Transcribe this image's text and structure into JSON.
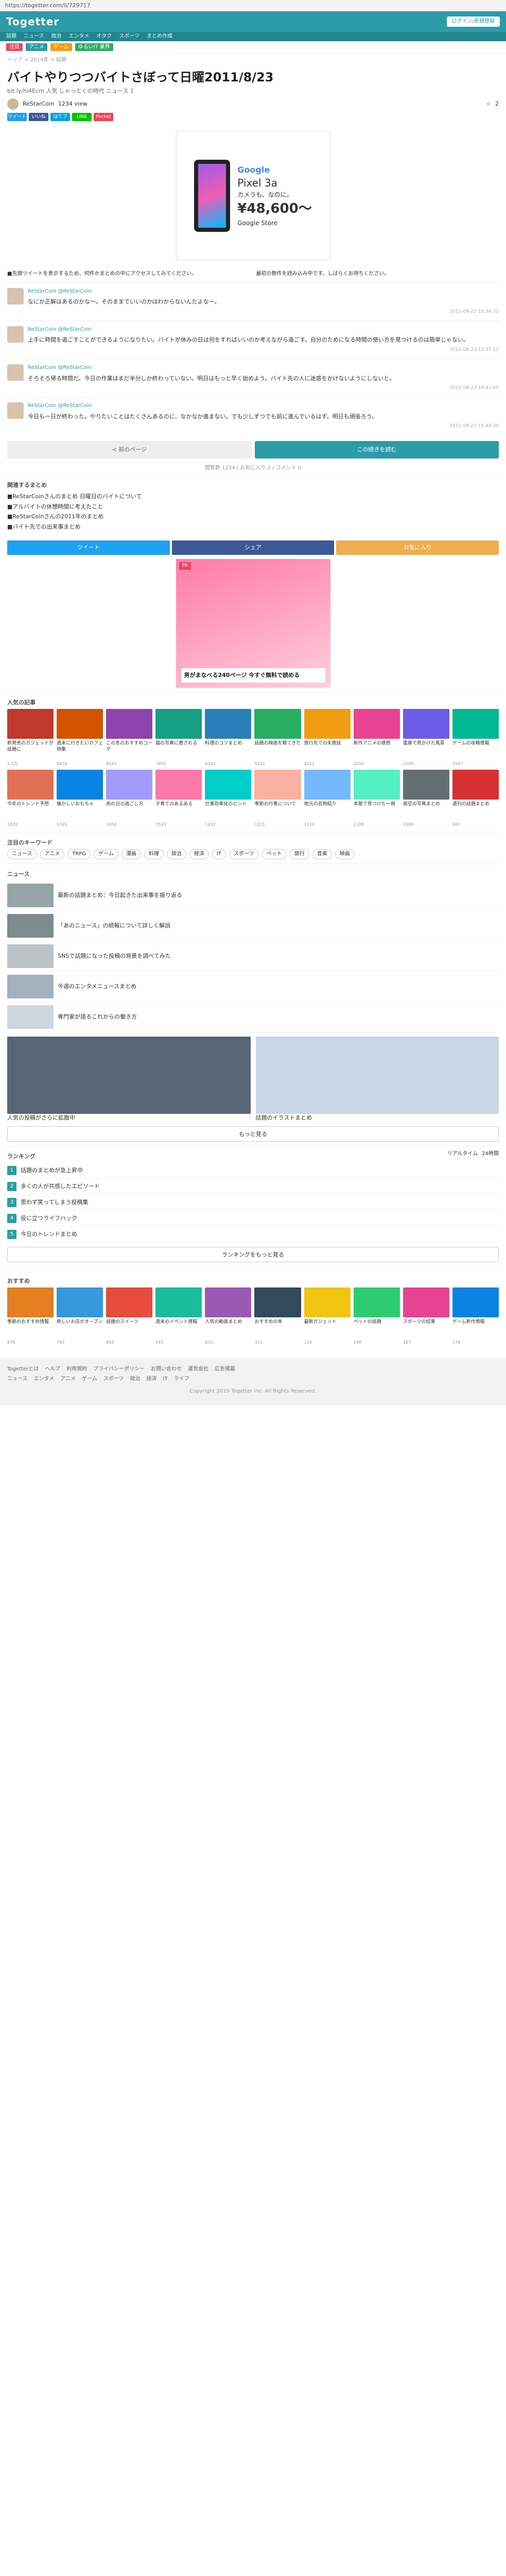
{
  "browser": {
    "url": "https://togetter.com/li/729717"
  },
  "header": {
    "logo": "Togetter",
    "button": "ログイン/新規登録",
    "subnav": [
      "話題",
      "ニュース",
      "政治",
      "エンタメ",
      "オタク",
      "スポーツ",
      "まとめ作成"
    ]
  },
  "tags": [
    {
      "t": "注目",
      "c": "#e94560"
    },
    {
      "t": "アニメ",
      "c": "#2c9ca8"
    },
    {
      "t": "ゲーム",
      "c": "#f39c12"
    },
    {
      "t": "ゆるいIT 業界",
      "c": "#27ae60"
    }
  ],
  "article": {
    "breadcrumb": "トップ > 2014年 > 話題",
    "title": "バイトやりつつバイトさぼって日曜2011/8/23",
    "subtitle": "bit.ly/hi4Ecm 人気 しゃっとくの時代 ニュース 1",
    "author": "ReStarCoin",
    "views": "1234 view",
    "fav_count": "2",
    "share": [
      {
        "t": "ツイート",
        "c": "#1da1f2"
      },
      {
        "t": "いいね",
        "c": "#3b5998"
      },
      {
        "t": "はてブ",
        "c": "#00a4de"
      },
      {
        "t": "LINE",
        "c": "#00c300"
      },
      {
        "t": "Pocket",
        "c": "#ef4056"
      }
    ]
  },
  "ad": {
    "brand": "Google",
    "product": "Pixel 3a",
    "tag": "カメラも、なのに。",
    "price": "¥48,600〜",
    "note": "Google Store"
  },
  "infocols": {
    "left": "■先頭ツイートを表示するため、何件かまとめの中にアクセスしてみてください。",
    "right": "最初の数件を読み込み中です。しばらくお待ちください。"
  },
  "tweets": [
    {
      "name": "ReStarCoin @ReStarCoin",
      "text": "なにか正解はあるのかな〜。そのままでいいのかはわからないんだよなー。",
      "time": "2011-08-23 15:34:51"
    },
    {
      "name": "ReStarCoin @ReStarCoin",
      "text": "上手に時間を過ごすことができるようになりたい。バイトが休みの日は何をすればいいのか考えながら過ごす。自分のためになる時間の使い方を見つけるのは簡単じゃない。",
      "time": "2011-08-23 15:37:12"
    },
    {
      "name": "ReStarCoin @ReStarCoin",
      "text": "そろそろ帰る時間だ。今日の作業はまだ半分しか終わっていない。明日はもっと早く始めよう。バイト先の人に迷惑をかけないようにしないと。",
      "time": "2011-08-23 15:41:05"
    },
    {
      "name": "ReStarCoin @ReStarCoin",
      "text": "今日も一日が終わった。やりたいことはたくさんあるのに、なかなか進まない。でも少しずつでも前に進んでいるはず。明日も頑張ろう。",
      "time": "2011-08-23 15:44:30"
    }
  ],
  "pager": {
    "prev": "< 前のページ",
    "next": "この続きを読む"
  },
  "stats": "閲覧数 1234 / お気に入り 2 / コメント 0",
  "related": {
    "head": "関連するまとめ",
    "items": [
      "■ReStarCoinさんのまとめ 日曜日のバイトについて",
      "■アルバイトの休憩時間に考えたこと",
      "■ReStarCoinさんの2011年のまとめ",
      "■バイト先での出来事まとめ"
    ]
  },
  "bigshare": [
    {
      "t": "ツイート",
      "c": "#1da1f2"
    },
    {
      "t": "シェア",
      "c": "#3b5998"
    },
    {
      "t": "お気に入り",
      "c": "#f0ad4e"
    }
  ],
  "promo": {
    "label": "PR",
    "text": "男がまなべる240ページ 今すぐ無料で読める"
  },
  "grid1": {
    "head": "人気の記事",
    "items": [
      {
        "t": "新発売のガジェットが話題に",
        "m": "1.2万",
        "c": "#c0392b"
      },
      {
        "t": "週末に行きたいカフェ特集",
        "m": "9876",
        "c": "#d35400"
      },
      {
        "t": "この冬のおすすめコーデ",
        "m": "8543",
        "c": "#8e44ad"
      },
      {
        "t": "猫の写真に癒される",
        "m": "7654",
        "c": "#16a085"
      },
      {
        "t": "料理のコツまとめ",
        "m": "6543",
        "c": "#2980b9"
      },
      {
        "t": "話題の映画を観てきた",
        "m": "5432",
        "c": "#27ae60"
      },
      {
        "t": "旅行先での失敗談",
        "m": "4321",
        "c": "#f39c12"
      },
      {
        "t": "新作アニメの感想",
        "m": "3210",
        "c": "#e84393"
      },
      {
        "t": "電車で見かけた風景",
        "m": "2109",
        "c": "#6c5ce7"
      },
      {
        "t": "ゲームの攻略情報",
        "m": "1987",
        "c": "#00b894"
      },
      {
        "t": "今年のトレンド予想",
        "m": "1876",
        "c": "#e17055"
      },
      {
        "t": "懐かしいおもちゃ",
        "m": "1765",
        "c": "#0984e3"
      },
      {
        "t": "雨の日の過ごし方",
        "m": "1654",
        "c": "#a29bfe"
      },
      {
        "t": "子育てのあるある",
        "m": "1543",
        "c": "#fd79a8"
      },
      {
        "t": "仕事効率化のヒント",
        "m": "1432",
        "c": "#00cec9"
      },
      {
        "t": "季節の行事について",
        "m": "1321",
        "c": "#fab1a0"
      },
      {
        "t": "地元の名物紹介",
        "m": "1210",
        "c": "#74b9ff"
      },
      {
        "t": "本屋で見つけた一冊",
        "m": "1109",
        "c": "#55efc4"
      },
      {
        "t": "夜空の写真まとめ",
        "m": "1098",
        "c": "#636e72"
      },
      {
        "t": "週刊の話題まとめ",
        "m": "987",
        "c": "#d63031"
      }
    ]
  },
  "chips": {
    "head": "注目のキーワード",
    "items": [
      "ニュース",
      "アニメ",
      "TRPG",
      "ゲーム",
      "漫画",
      "料理",
      "政治",
      "経済",
      "IT",
      "スポーツ",
      "ペット",
      "旅行",
      "音楽",
      "映画"
    ]
  },
  "news": {
    "head": "ニュース",
    "items": [
      {
        "t": "最新の話題まとめ：今日起きた出来事を振り返る",
        "c": "#95a5a6"
      },
      {
        "t": "「あのニュース」の続報について詳しく解説",
        "c": "#7f8c8d"
      },
      {
        "t": "SNSで話題になった投稿の背景を調べてみた",
        "c": "#bdc3c7"
      },
      {
        "t": "今週のエンタメニュースまとめ",
        "c": "#a4b0be"
      },
      {
        "t": "専門家が語るこれからの働き方",
        "c": "#ced6e0"
      }
    ]
  },
  "bigpair": [
    {
      "t": "人気の投稿がさらに拡散中",
      "c": "#576574"
    },
    {
      "t": "話題のイラストまとめ",
      "c": "#c8d6e5"
    }
  ],
  "more1": "もっと見る",
  "ranking": {
    "head": "ランキング",
    "tabs": [
      "リアルタイム",
      "24時間"
    ],
    "items": [
      "話題のまとめが急上昇中",
      "多くの人が共感したエピソード",
      "思わず笑ってしまう投稿集",
      "役に立つライフハック",
      "今日のトレンドまとめ"
    ]
  },
  "more2": "ランキングをもっと見る",
  "grid2": {
    "head": "おすすめ",
    "items": [
      {
        "t": "季節のおすすめ情報",
        "m": "876",
        "c": "#e67e22"
      },
      {
        "t": "新しいお店がオープン",
        "m": "765",
        "c": "#3498db"
      },
      {
        "t": "話題のスイーツ",
        "m": "654",
        "c": "#e74c3c"
      },
      {
        "t": "週末のイベント情報",
        "m": "543",
        "c": "#1abc9c"
      },
      {
        "t": "人気の動画まとめ",
        "m": "432",
        "c": "#9b59b6"
      },
      {
        "t": "おすすめの本",
        "m": "321",
        "c": "#34495e"
      },
      {
        "t": "最新ガジェット",
        "m": "210",
        "c": "#f1c40f"
      },
      {
        "t": "ペットの話題",
        "m": "198",
        "c": "#2ecc71"
      },
      {
        "t": "スポーツの結果",
        "m": "187",
        "c": "#e84393"
      },
      {
        "t": "ゲーム新作情報",
        "m": "176",
        "c": "#0984e3"
      }
    ]
  },
  "footer": {
    "links": [
      "Togetterとは",
      "ヘルプ",
      "利用規約",
      "プライバシーポリシー",
      "お問い合わせ",
      "運営会社",
      "広告掲載"
    ],
    "cats": [
      "ニュース",
      "エンタメ",
      "アニメ",
      "ゲーム",
      "スポーツ",
      "政治",
      "経済",
      "IT",
      "ライフ"
    ],
    "copyright": "Copyright 2019 Togetter Inc. All Rights Reserved."
  }
}
